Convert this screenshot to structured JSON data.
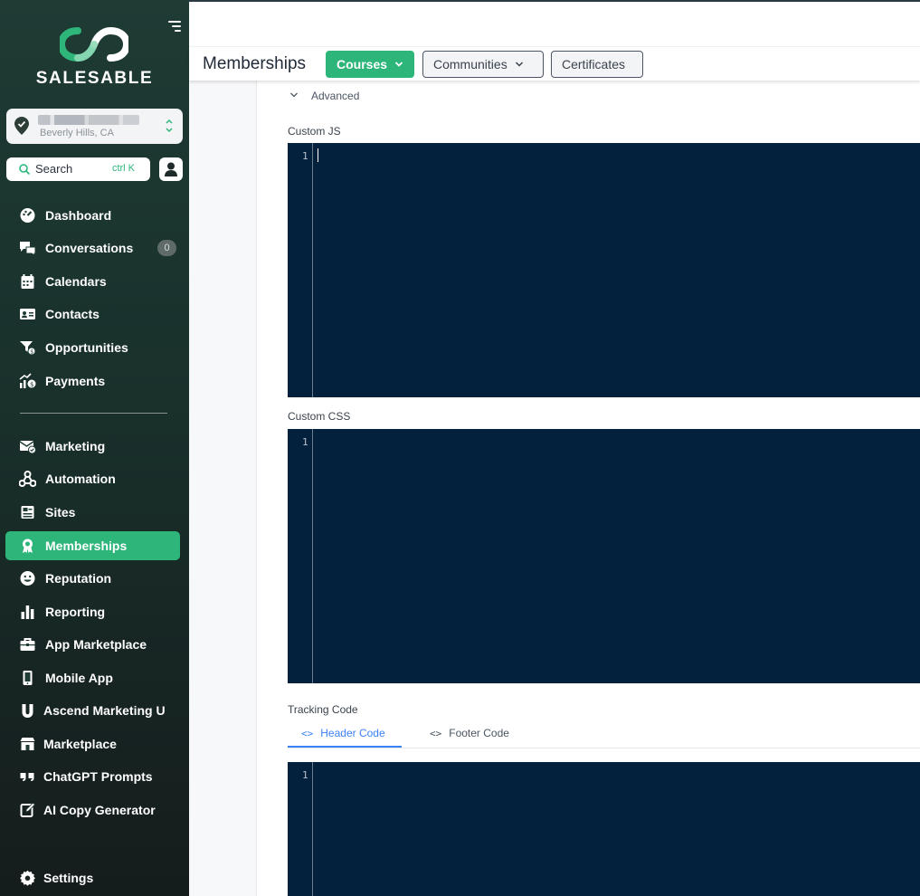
{
  "app": {
    "brand": "SALESABLE"
  },
  "location": {
    "name": "",
    "city": "Beverly Hills, CA"
  },
  "search": {
    "label": "Search",
    "shortcut": "ctrl K"
  },
  "nav": {
    "primary": [
      {
        "label": "Dashboard",
        "icon": "dashboard-icon"
      },
      {
        "label": "Conversations",
        "icon": "chat-icon",
        "badge": "0"
      },
      {
        "label": "Calendars",
        "icon": "calendar-icon"
      },
      {
        "label": "Contacts",
        "icon": "contact-card-icon"
      },
      {
        "label": "Opportunities",
        "icon": "funnel-icon"
      },
      {
        "label": "Payments",
        "icon": "payments-icon"
      }
    ],
    "secondary": [
      {
        "label": "Marketing",
        "icon": "mail-check-icon"
      },
      {
        "label": "Automation",
        "icon": "workflow-icon"
      },
      {
        "label": "Sites",
        "icon": "sites-icon"
      },
      {
        "label": "Memberships",
        "icon": "award-icon",
        "active": true
      },
      {
        "label": "Reputation",
        "icon": "smiley-icon"
      },
      {
        "label": "Reporting",
        "icon": "bar-chart-icon"
      },
      {
        "label": "App Marketplace",
        "icon": "briefcase-icon"
      },
      {
        "label": "Mobile App",
        "icon": "mobile-icon"
      },
      {
        "label": "Ascend Marketing U",
        "icon": "u-letter-icon"
      },
      {
        "label": "Marketplace",
        "icon": "storefront-icon"
      },
      {
        "label": "ChatGPT Prompts",
        "icon": "quote-icon"
      },
      {
        "label": "AI Copy Generator",
        "icon": "edit-icon"
      }
    ],
    "settings": {
      "label": "Settings",
      "icon": "gear-icon"
    }
  },
  "header": {
    "title": "Memberships",
    "tabs": [
      {
        "label": "Courses",
        "active": true,
        "has_dropdown": true
      },
      {
        "label": "Communities",
        "active": false,
        "has_dropdown": true
      },
      {
        "label": "Certificates",
        "active": false,
        "has_dropdown": false
      }
    ]
  },
  "main": {
    "advanced_label": "Advanced",
    "custom_js": {
      "label": "Custom JS",
      "line_number": "1"
    },
    "custom_css": {
      "label": "Custom CSS",
      "line_number": "1"
    },
    "tracking": {
      "label": "Tracking Code",
      "tabs": [
        {
          "label": "Header Code",
          "glyph": "<>",
          "active": true
        },
        {
          "label": "Footer Code",
          "glyph": "<>",
          "active": false
        }
      ],
      "line_number": "1"
    }
  },
  "colors": {
    "accent": "#2db57a",
    "sidebar_bg": "#1e3b34",
    "editor_bg": "#03203d",
    "link_blue": "#3b82f6"
  }
}
